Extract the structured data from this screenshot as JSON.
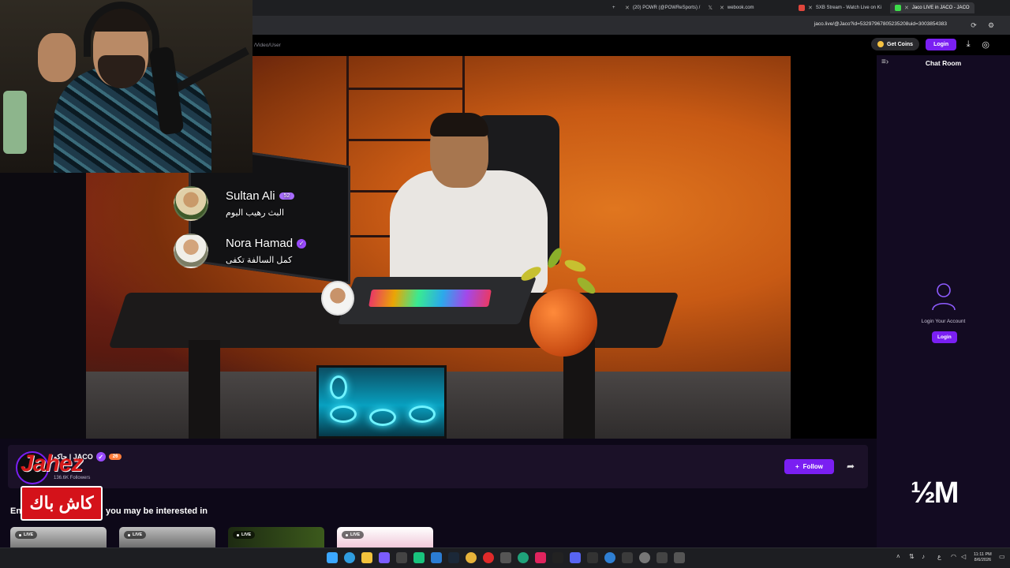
{
  "browser": {
    "tabs": [
      {
        "label": "(20) POWR (@POWReSports) /",
        "active": false
      },
      {
        "label": "webook.com",
        "active": false
      },
      {
        "label": "SXB Stream - Watch Live on Ki",
        "active": false
      },
      {
        "label": "Jaco LIVE in JACO - JACO",
        "active": true
      }
    ],
    "new_tab_icon": "plus-icon",
    "url": "jaco.live/@Jaco?id=53297967805235208uid=3003854383"
  },
  "page": {
    "breadcrumb": "/Video/User",
    "get_coins_label": "Get Coins",
    "login_label": "Login",
    "chat_title": "Chat Room",
    "login_account_text": "Login Your Account",
    "login_small_label": "Login"
  },
  "video_overlay": {
    "comments": [
      {
        "name": "Sultan Ali",
        "level": "52",
        "message": "البث رهيب اليوم"
      },
      {
        "name": "Nora Hamad",
        "message": "كمل السالفة تكفى"
      }
    ]
  },
  "streamer": {
    "name": "جاكو | JACO",
    "level": "26",
    "followers": "136.6K Followers",
    "follow_label": "Follow",
    "watermark": "Jahez",
    "cashback": "كاش باك"
  },
  "recommend": {
    "prefix": "En",
    "title": "you may be interested in",
    "cards": [
      {
        "live_label": "LIVE"
      },
      {
        "live_label": "LIVE"
      },
      {
        "live_label": "LIVE"
      },
      {
        "live_label": "LIVE"
      }
    ]
  },
  "overlay_text": "½M",
  "taskbar": {
    "time": "11:11 PM",
    "date": "8/6/2026",
    "lang": "ع"
  },
  "colors": {
    "accent": "#7a1ff2",
    "sidebar_bg": "#130b22",
    "cashback_red": "#d4121a"
  }
}
